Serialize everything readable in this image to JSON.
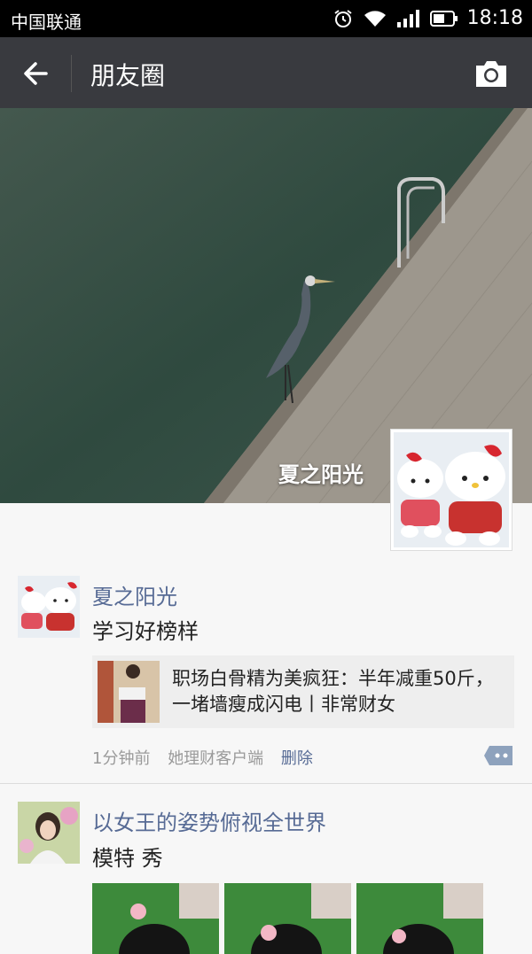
{
  "status_bar": {
    "carrier": "中国联通",
    "time": "18:18"
  },
  "header": {
    "title": "朋友圈"
  },
  "cover": {
    "name": "夏之阳光"
  },
  "posts": [
    {
      "author": "夏之阳光",
      "text": "学习好榜样",
      "link_title": "职场白骨精为美疯狂：半年减重50斤，一堵墙瘦成闪电丨非常财女",
      "time": "1分钟前",
      "source": "她理财客户端",
      "delete_label": "删除"
    },
    {
      "author": "以女王的姿势俯视全世界",
      "text": "模特 秀"
    }
  ],
  "colors": {
    "titlebar": "#393a3f",
    "name_link": "#576b95",
    "meta": "#9a9a9a"
  }
}
